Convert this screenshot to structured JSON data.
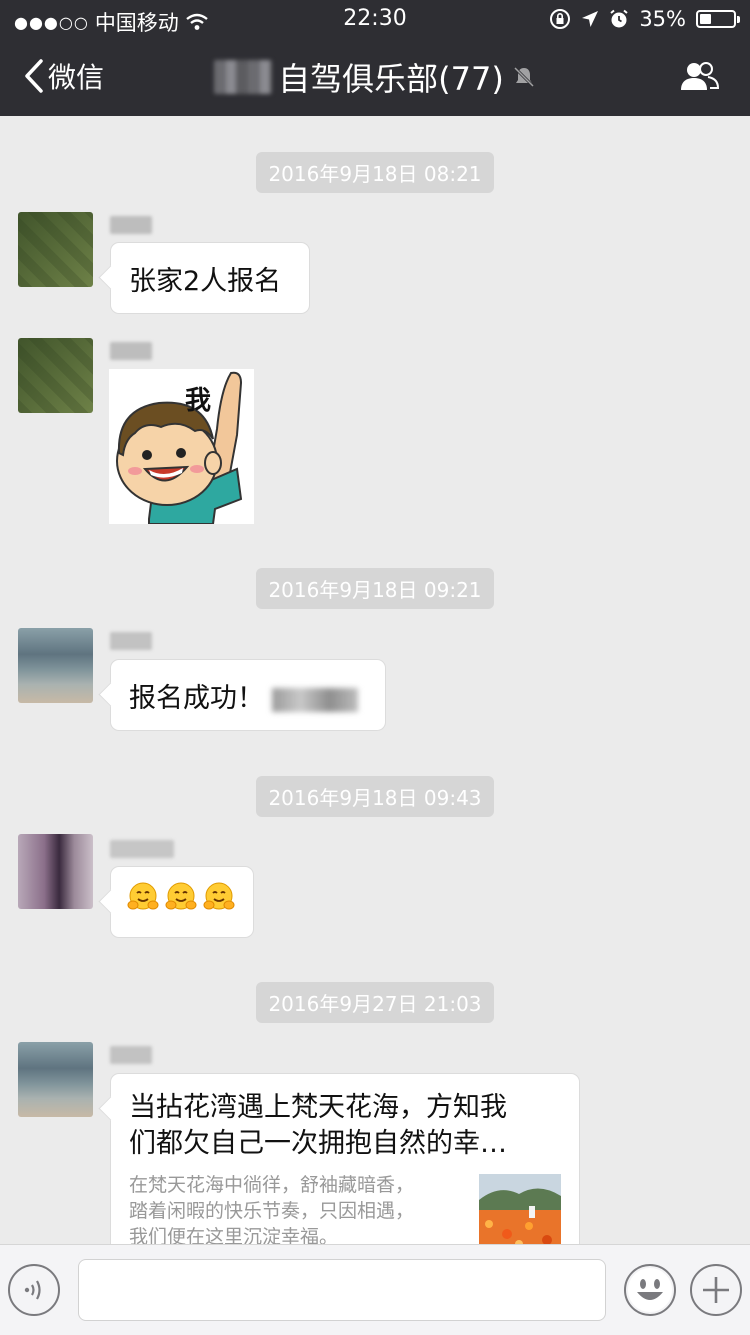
{
  "status_bar": {
    "carrier": "中国移动",
    "time": "22:30",
    "battery_text": "35%",
    "battery_level": 0.35
  },
  "nav": {
    "back_label": "微信",
    "title": "自驾俱乐部(77)"
  },
  "messages": {
    "ts1": "2016年9月18日 08:21",
    "msg1_text": "张家2人报名",
    "sticker_text": "我",
    "ts2": "2016年9月18日 09:21",
    "msg3_text": "报名成功！",
    "ts3": "2016年9月18日 09:43",
    "ts4": "2016年9月27日 21:03",
    "link": {
      "title_line1": "当拈花湾遇上梵天花海，方知我",
      "title_line2": "们都欠自己一次拥抱自然的幸…",
      "desc_line1": "在梵天花海中徜徉，舒袖藏暗香，",
      "desc_line2": "踏着闲暇的快乐节奏，只因相遇，",
      "desc_line3": "我们便在这里沉淀幸福。"
    }
  },
  "colors": {
    "nav_bg": "#2e2e33",
    "chat_bg": "#ebebeb",
    "timestamp_bg": "#d6d6d6"
  }
}
